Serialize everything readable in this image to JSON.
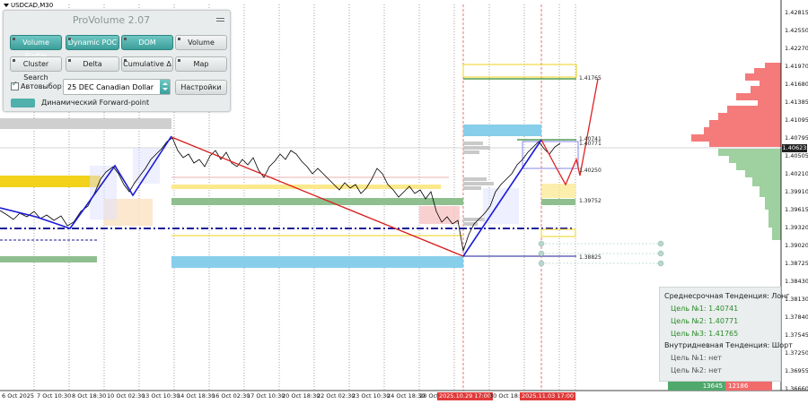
{
  "window": {
    "symbol": "USDCAD,M30"
  },
  "panel": {
    "title": "ProVolume 2.07",
    "buttons": [
      {
        "label": "Volume Profile",
        "active": true
      },
      {
        "label": "Dynamic POC",
        "active": true
      },
      {
        "label": "DOM",
        "active": true
      },
      {
        "label": "Volume",
        "active": false
      },
      {
        "label": "Cluster Search",
        "active": false
      },
      {
        "label": "Delta",
        "active": false
      },
      {
        "label": "Cumulative Δ",
        "active": false
      },
      {
        "label": "Map",
        "active": false
      }
    ],
    "autoselect_label": "Автовыбор",
    "autoselect_checked": true,
    "instrument_value": "25 DEC Canadian Dollar",
    "settings_label": "Настройки",
    "forward_label": "Динамический Forward-point"
  },
  "price_axis": [
    "1.42815",
    "1.42550",
    "1.42270",
    "1.41970",
    "1.41680",
    "1.41385",
    "1.41095",
    "1.40795",
    "1.40505",
    "1.40210",
    "1.39910",
    "1.39615",
    "1.39320",
    "1.39020",
    "1.38725",
    "1.38430",
    "1.38130",
    "1.37840",
    "1.37545",
    "1.37250",
    "1.36955",
    "1.36660"
  ],
  "current_price": "1.40623",
  "level_labels": {
    "target3": "1.41765",
    "target1": "1.40741",
    "target2": "1.40771",
    "mid": "1.40250",
    "support": "1.39752",
    "low": "1.38825"
  },
  "date_axis": [
    "6 Oct 2025",
    "7 Oct 10:30",
    "8 Oct 18:30",
    "10 Oct 02:30",
    "13 Oct 10:30",
    "14 Oct 18:30",
    "16 Oct 02:30",
    "17 Oct 10:30",
    "20 Oct 18:30",
    "22 Oct 02:30",
    "23 Oct 10:30",
    "24 Oct 18:30",
    "28 Oct 0"
  ],
  "date_axis_red": [
    "2025.10.29 17:00",
    "2025.11.03 17:00"
  ],
  "date_axis_after": "30 Oct 18:30",
  "info": {
    "mid_trend": "Среднесрочная Тенденция: Лонг",
    "targets_long": [
      "Цель №1: 1.40741",
      "Цель №2: 1.40771",
      "Цель №3: 1.41765"
    ],
    "intraday_trend": "Внутридневная Тенденция: Шорт",
    "targets_short": [
      "Цель №1: нет",
      "Цель №2: нет"
    ]
  },
  "volume": {
    "buy": "13645",
    "sell": "12186"
  },
  "colors": {
    "up_trend": "#1a1ad6",
    "down_trend": "#d81a1a",
    "zone_yellow": "#f2d21a",
    "zone_blue": "#87ceeb",
    "zone_green": "#7fb77f",
    "profile_red": "#f57a7a",
    "profile_green": "#9fd09f"
  }
}
